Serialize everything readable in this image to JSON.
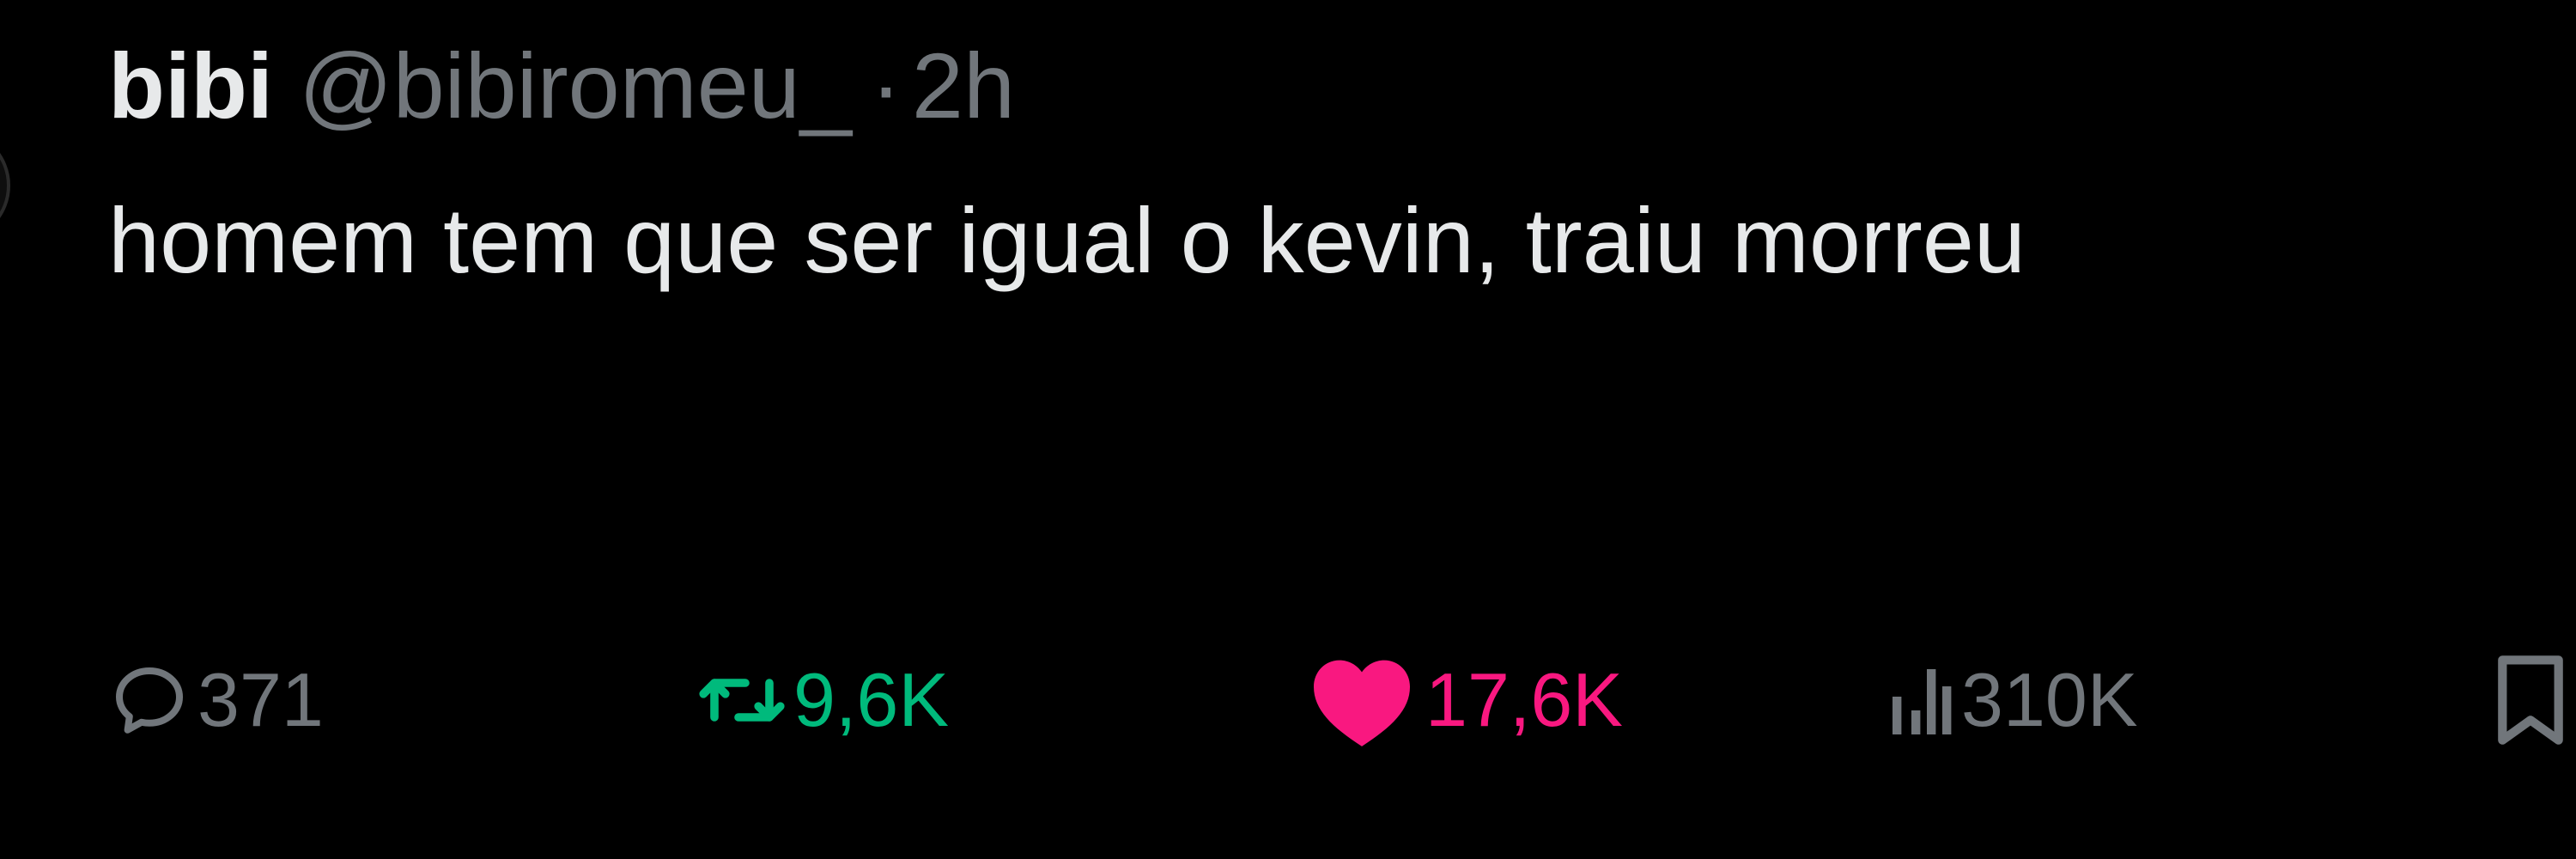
{
  "tweet": {
    "author_name": "bibi",
    "handle": "@bibiromeu_",
    "separator": "·",
    "time": "2h",
    "text": "homem tem que ser igual o kevin, traiu morreu"
  },
  "actions": {
    "reply": {
      "icon": "speech-bubble-icon",
      "count": "371"
    },
    "retweet": {
      "icon": "retweet-arrows-icon",
      "count": "9,6K",
      "color": "#00ba7c"
    },
    "like": {
      "icon": "heart-filled-icon",
      "count": "17,6K",
      "color": "#f91880"
    },
    "views": {
      "icon": "bar-chart-icon",
      "count": "310K"
    },
    "bookmark": {
      "icon": "bookmark-icon"
    }
  },
  "colors": {
    "background": "#000000",
    "text": "#e7e9ea",
    "muted": "#71767b"
  }
}
